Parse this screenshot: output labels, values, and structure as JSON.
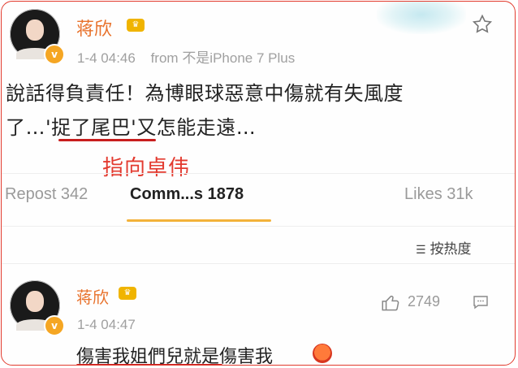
{
  "post": {
    "author": "蒋欣",
    "timestamp": "1-4 04:46",
    "source_prefix": "from",
    "source": "不是iPhone 7 Plus",
    "text_line1": "說話得負責任！為博眼球惡意中傷就有失風度",
    "text_line2": "了…'捉了尾巴'又怎能走遠…"
  },
  "annotation": "指向卓伟",
  "stats": {
    "repost": "Repost 342",
    "comments": "Comm...s 1878",
    "likes": "Likes 31k"
  },
  "sort": {
    "label": "按热度",
    "icon": "sort-icon"
  },
  "comment": {
    "author": "蒋欣",
    "timestamp": "1-4 04:47",
    "likes": "2749",
    "text": "傷害我姐們兒就是傷害我"
  },
  "colors": {
    "name": "#e8722c",
    "annotation": "#e33a2f",
    "underline": "#c81e1e",
    "active_tab": "#f3b23a",
    "frame_border": "#e23b2e"
  }
}
